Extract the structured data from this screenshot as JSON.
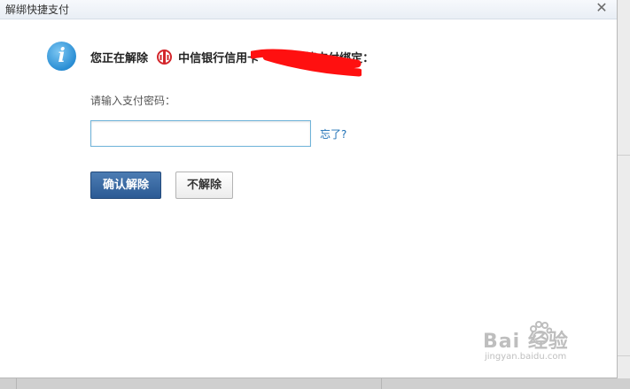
{
  "dialog": {
    "title": "解绑快捷支付",
    "close_glyph": "✕"
  },
  "notice": {
    "icon": "info-icon",
    "prefix": "您正在解除",
    "bank_logo_icon": "citic-bank-logo",
    "bank_text": "中信银行信用卡",
    "suffix": "快捷支付绑定："
  },
  "password": {
    "label": "请输入支付密码：",
    "value": "",
    "placeholder": ""
  },
  "forgot_link": "忘了?",
  "buttons": {
    "confirm": "确认解除",
    "cancel": "不解除"
  },
  "watermark": {
    "main": "Bai  经验",
    "sub": "jingyan.baidu.com"
  },
  "colors": {
    "accent": "#2b5a94",
    "link": "#1c6fb5",
    "info": "#2a8ed4",
    "bank_logo": "#d3262b"
  }
}
